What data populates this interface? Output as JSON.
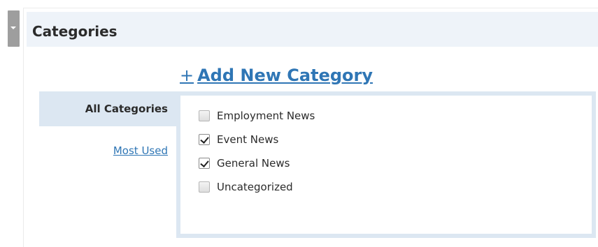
{
  "panel": {
    "title": "Categories"
  },
  "add_category_link": {
    "plus": "+",
    "label": "Add New Category"
  },
  "tabs": [
    {
      "label": "All Categories",
      "active": true
    },
    {
      "label": "Most Used",
      "active": false
    }
  ],
  "categories": [
    {
      "label": "Employment News",
      "checked": false
    },
    {
      "label": "Event News",
      "checked": true
    },
    {
      "label": "General News",
      "checked": true
    },
    {
      "label": "Uncategorized",
      "checked": false
    }
  ],
  "colors": {
    "header_bg": "#eef3f9",
    "tab_active_bg": "#dce7f2",
    "link": "#2f76b5",
    "handle": "#9e9e9e"
  }
}
